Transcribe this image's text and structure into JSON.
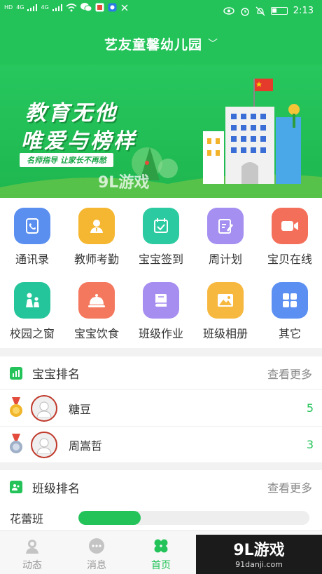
{
  "status_bar": {
    "left_marks": [
      "HD",
      "4G",
      "4G"
    ],
    "time": "2:13"
  },
  "header": {
    "school_name": "艺友童馨幼儿园",
    "dropdown_glyph": "﹀"
  },
  "banner": {
    "slogan_line1": "教育无他",
    "slogan_line2": "唯爱与榜样",
    "tagline": "名师指导 让家长不再愁",
    "watermark": "9L游戏"
  },
  "grid": {
    "items": [
      {
        "label": "通讯录",
        "icon": "contacts-icon",
        "color": "#5a8ff0"
      },
      {
        "label": "教师考勤",
        "icon": "teacher-attendance-icon",
        "color": "#f5b731"
      },
      {
        "label": "宝宝签到",
        "icon": "checkin-calendar-icon",
        "color": "#2ccaa0"
      },
      {
        "label": "周计划",
        "icon": "edit-plan-icon",
        "color": "#a58ff0"
      },
      {
        "label": "宝贝在线",
        "icon": "video-camera-icon",
        "color": "#f46f5a"
      },
      {
        "label": "校园之窗",
        "icon": "campus-window-icon",
        "color": "#25c59b"
      },
      {
        "label": "宝宝饮食",
        "icon": "food-cloche-icon",
        "color": "#f4785e"
      },
      {
        "label": "班级作业",
        "icon": "homework-book-icon",
        "color": "#a68df0"
      },
      {
        "label": "班级相册",
        "icon": "photo-album-icon",
        "color": "#f7b840"
      },
      {
        "label": "其它",
        "icon": "more-apps-icon",
        "color": "#5b8ff2"
      }
    ]
  },
  "baby_rank": {
    "title": "宝宝排名",
    "more": "查看更多",
    "rows": [
      {
        "name": "糖豆",
        "score": "5",
        "medal_color": "#f1b52a"
      },
      {
        "name": "周嵩哲",
        "score": "3",
        "medal_color": "#9fb0c8"
      }
    ]
  },
  "class_rank": {
    "title": "班级排名",
    "more": "查看更多",
    "rows": [
      {
        "name": "花蕾班",
        "progress": 0.27
      }
    ]
  },
  "tab_bar": {
    "tabs": [
      {
        "label": "动态",
        "icon": "feed-icon",
        "active": false
      },
      {
        "label": "消息",
        "icon": "message-icon",
        "active": false
      },
      {
        "label": "首页",
        "icon": "home-clover-icon",
        "active": true
      }
    ]
  },
  "corner_watermark": {
    "title": "9L游戏",
    "url": "91danji.com"
  },
  "colors": {
    "brand_green": "#23c35a",
    "rank_score": "#23c35a"
  }
}
